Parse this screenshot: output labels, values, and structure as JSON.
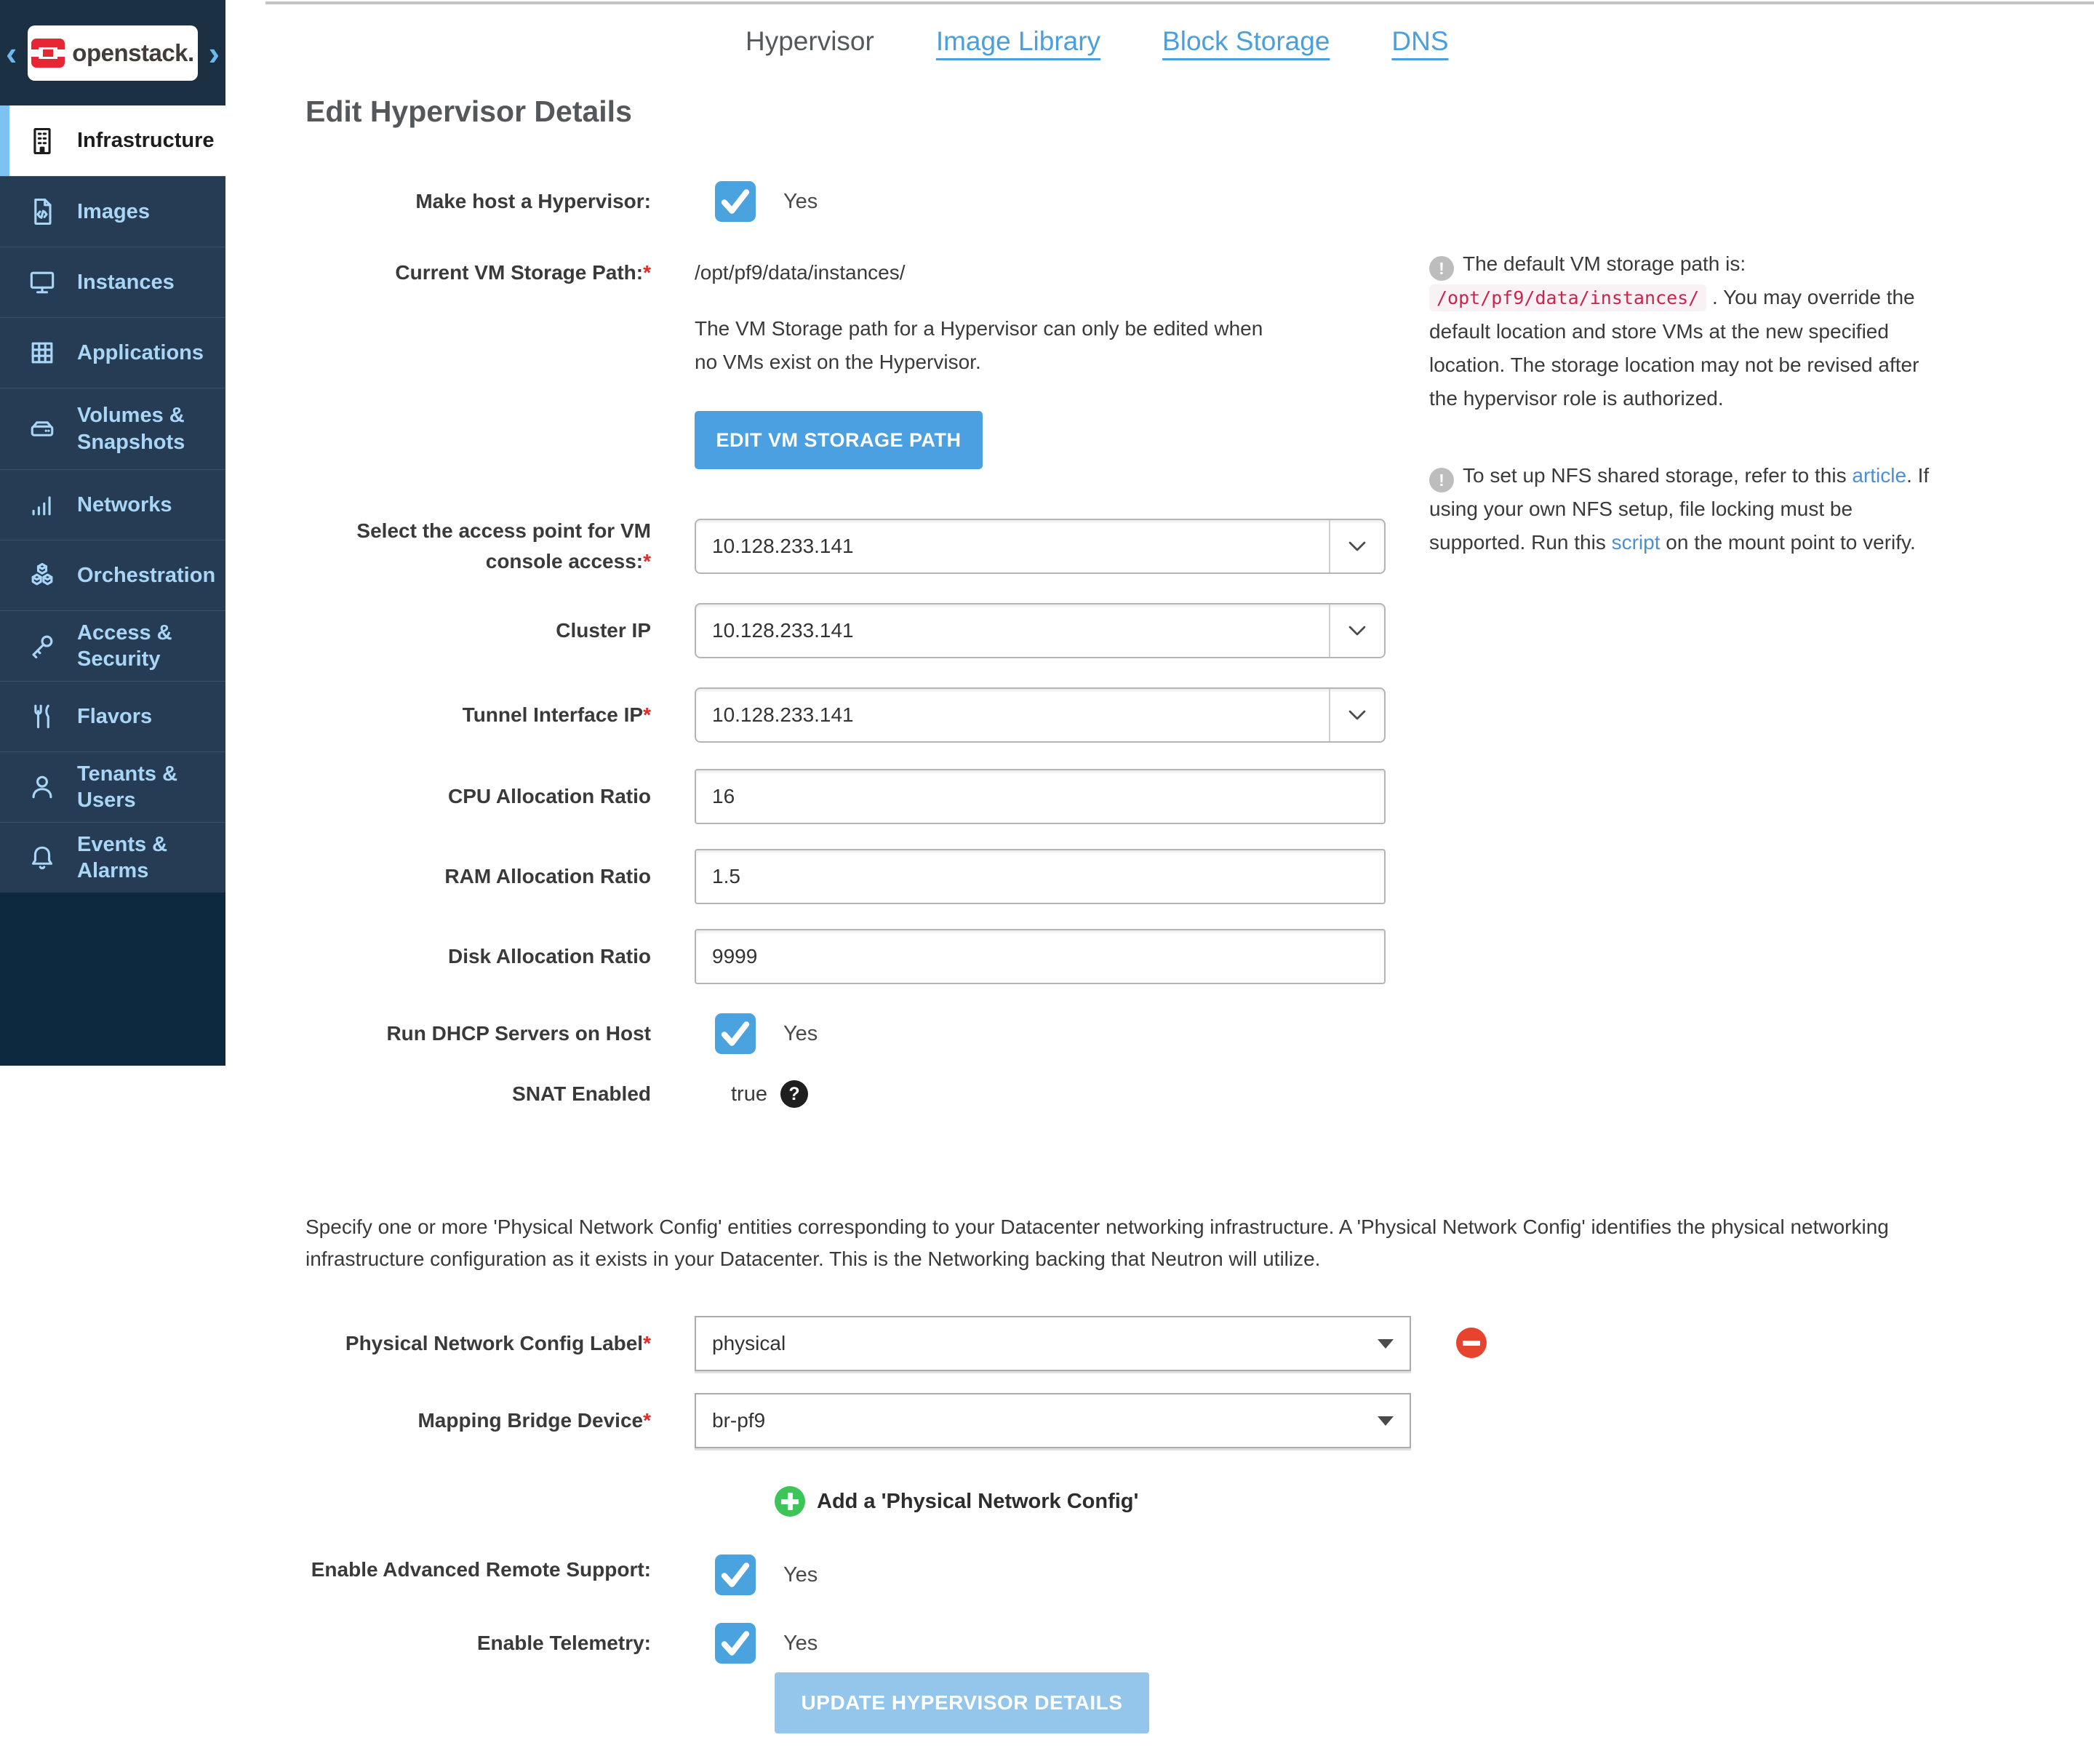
{
  "colors": {
    "sidebar_header_bg": "#1c3044",
    "sidebar_items_bg": "#253c54",
    "sidebar_bottom_bg": "#0d2940",
    "sidebar_text": "#a9d6f7",
    "active_accent": "#7cc3f2",
    "primary_blue": "#4aa0e0",
    "disabled_blue": "#94c6eb",
    "checkbox_blue": "#4aa3df",
    "link_blue": "#4a9fdc",
    "required_red": "#e02b2b",
    "remove_red": "#e8432e",
    "add_green": "#3ec459",
    "code_pink": "#c7254e",
    "openstack_logo_red": "#e52635"
  },
  "sidebar": {
    "logo_text": "openstack.",
    "items": [
      {
        "label": "Infrastructure",
        "icon": "building-icon",
        "active": true
      },
      {
        "label": "Images",
        "icon": "image-file-icon",
        "active": false
      },
      {
        "label": "Instances",
        "icon": "monitor-icon",
        "active": false
      },
      {
        "label": "Applications",
        "icon": "grid-icon",
        "active": false
      },
      {
        "label": "Volumes & Snapshots",
        "icon": "drive-icon",
        "active": false
      },
      {
        "label": "Networks",
        "icon": "signal-bars-icon",
        "active": false
      },
      {
        "label": "Orchestration",
        "icon": "cubes-icon",
        "active": false
      },
      {
        "label": "Access & Security",
        "icon": "key-icon",
        "active": false
      },
      {
        "label": "Flavors",
        "icon": "utensils-icon",
        "active": false
      },
      {
        "label": "Tenants & Users",
        "icon": "user-icon",
        "active": false
      },
      {
        "label": "Events & Alarms",
        "icon": "bell-icon",
        "active": false
      }
    ]
  },
  "tabs": {
    "hypervisor": "Hypervisor",
    "image_library": "Image Library",
    "block_storage": "Block Storage",
    "dns": "DNS"
  },
  "page": {
    "title": "Edit Hypervisor Details"
  },
  "form": {
    "make_host": {
      "label": "Make host a Hypervisor:",
      "value": "Yes",
      "checked": true
    },
    "storage_path": {
      "label": "Current VM Storage Path:",
      "required": "*",
      "value": "/opt/pf9/data/instances/",
      "help": "The VM Storage path for a Hypervisor can only be edited when no VMs exist on the Hypervisor.",
      "button": "EDIT VM STORAGE PATH"
    },
    "access_point": {
      "label": "Select the access point for VM console access:",
      "required": "*",
      "value": "10.128.233.141"
    },
    "cluster_ip": {
      "label": "Cluster IP",
      "value": "10.128.233.141"
    },
    "tunnel_ip": {
      "label": "Tunnel Interface IP",
      "required": "*",
      "value": "10.128.233.141"
    },
    "cpu_ratio": {
      "label": "CPU Allocation Ratio",
      "value": "16"
    },
    "ram_ratio": {
      "label": "RAM Allocation Ratio",
      "value": "1.5"
    },
    "disk_ratio": {
      "label": "Disk Allocation Ratio",
      "value": "9999"
    },
    "dhcp": {
      "label": "Run DHCP Servers on Host",
      "value": "Yes",
      "checked": true
    },
    "snat": {
      "label": "SNAT Enabled",
      "value": "true"
    }
  },
  "info_panel": {
    "note1": {
      "lead": "The default VM storage path is: ",
      "code": "/opt/pf9/data/instances/",
      "rest": " . You may override the default location and store VMs at the new specified location. The storage location may not be revised after the hypervisor role is authorized."
    },
    "note2": {
      "part1": "To set up NFS shared storage, refer to this ",
      "link1": "article",
      "part2": ". If using your own NFS setup, file locking must be supported. Run this ",
      "link2": "script",
      "part3": " on the mount point to verify."
    }
  },
  "network_section": {
    "description": "Specify one or more 'Physical Network Config' entities corresponding to your Datacenter networking infrastructure. A 'Physical Network Config' identifies the physical networking infrastructure configuration as it exists in your Datacenter. This is the Networking backing that Neutron will utilize.",
    "config_label": {
      "label": "Physical Network Config Label",
      "required": "*",
      "value": "physical"
    },
    "bridge_device": {
      "label": "Mapping Bridge Device",
      "required": "*",
      "value": "br-pf9"
    },
    "add_link": "Add a 'Physical Network Config'",
    "remote_support": {
      "label": "Enable Advanced Remote Support:",
      "value": "Yes",
      "checked": true
    },
    "telemetry": {
      "label": "Enable Telemetry:",
      "value": "Yes",
      "checked": true
    },
    "update_button": "UPDATE HYPERVISOR DETAILS"
  }
}
